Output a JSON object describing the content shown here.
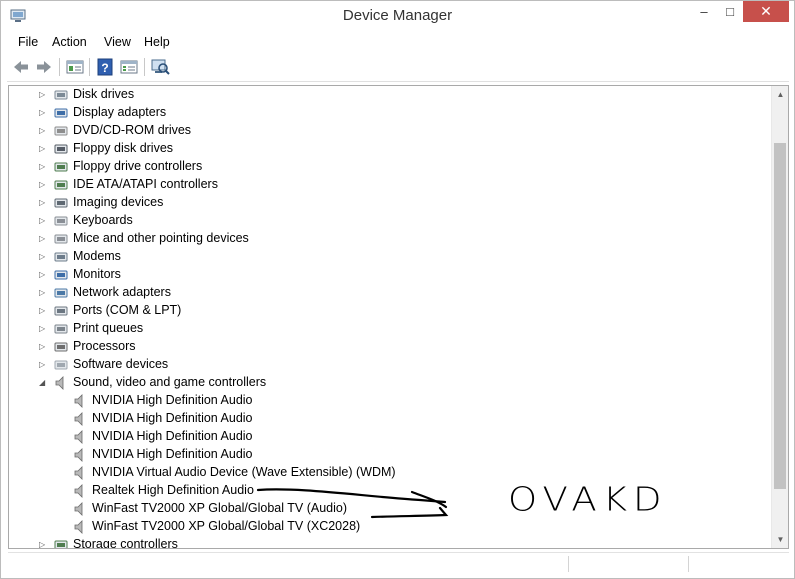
{
  "window": {
    "title": "Device Manager",
    "controls": {
      "minimize": "–",
      "maximize": "□",
      "close": "✕"
    }
  },
  "menu": {
    "items": [
      "File",
      "Action",
      "View",
      "Help"
    ]
  },
  "toolbar": {
    "buttons": [
      "back-icon",
      "forward-icon",
      "console-tree-icon",
      "help-icon",
      "properties-icon",
      "scan-hardware-icon"
    ]
  },
  "tree": {
    "items": [
      {
        "label": "Disk drives",
        "icon": "disk-drive-icon",
        "expanded": false,
        "level": 0
      },
      {
        "label": "Display adapters",
        "icon": "display-adapter-icon",
        "expanded": false,
        "level": 0
      },
      {
        "label": "DVD/CD-ROM drives",
        "icon": "dvd-drive-icon",
        "expanded": false,
        "level": 0
      },
      {
        "label": "Floppy disk drives",
        "icon": "floppy-disk-icon",
        "expanded": false,
        "level": 0
      },
      {
        "label": "Floppy drive controllers",
        "icon": "floppy-controller-icon",
        "expanded": false,
        "level": 0
      },
      {
        "label": "IDE ATA/ATAPI controllers",
        "icon": "ide-controller-icon",
        "expanded": false,
        "level": 0
      },
      {
        "label": "Imaging devices",
        "icon": "camera-icon",
        "expanded": false,
        "level": 0
      },
      {
        "label": "Keyboards",
        "icon": "keyboard-icon",
        "expanded": false,
        "level": 0
      },
      {
        "label": "Mice and other pointing devices",
        "icon": "mouse-icon",
        "expanded": false,
        "level": 0
      },
      {
        "label": "Modems",
        "icon": "modem-icon",
        "expanded": false,
        "level": 0
      },
      {
        "label": "Monitors",
        "icon": "monitor-icon",
        "expanded": false,
        "level": 0
      },
      {
        "label": "Network adapters",
        "icon": "network-adapter-icon",
        "expanded": false,
        "level": 0
      },
      {
        "label": "Ports (COM & LPT)",
        "icon": "port-icon",
        "expanded": false,
        "level": 0
      },
      {
        "label": "Print queues",
        "icon": "printer-icon",
        "expanded": false,
        "level": 0
      },
      {
        "label": "Processors",
        "icon": "processor-icon",
        "expanded": false,
        "level": 0
      },
      {
        "label": "Software devices",
        "icon": "software-device-icon",
        "expanded": false,
        "level": 0
      },
      {
        "label": "Sound, video and game controllers",
        "icon": "speaker-icon",
        "expanded": true,
        "level": 0
      },
      {
        "label": "NVIDIA High Definition Audio",
        "icon": "speaker-icon",
        "level": 1
      },
      {
        "label": "NVIDIA High Definition Audio",
        "icon": "speaker-icon",
        "level": 1
      },
      {
        "label": "NVIDIA High Definition Audio",
        "icon": "speaker-icon",
        "level": 1
      },
      {
        "label": "NVIDIA High Definition Audio",
        "icon": "speaker-icon",
        "level": 1
      },
      {
        "label": "NVIDIA Virtual Audio Device (Wave Extensible) (WDM)",
        "icon": "speaker-icon",
        "level": 1
      },
      {
        "label": "Realtek High Definition Audio",
        "icon": "speaker-icon",
        "level": 1
      },
      {
        "label": "WinFast TV2000 XP Global/Global TV (Audio)",
        "icon": "speaker-icon",
        "level": 1
      },
      {
        "label": "WinFast TV2000 XP Global/Global TV (XC2028)",
        "icon": "speaker-icon",
        "level": 1
      },
      {
        "label": "Storage controllers",
        "icon": "storage-controller-icon",
        "expanded": false,
        "level": 0
      }
    ]
  },
  "annotation": {
    "text": "OVAKD"
  }
}
